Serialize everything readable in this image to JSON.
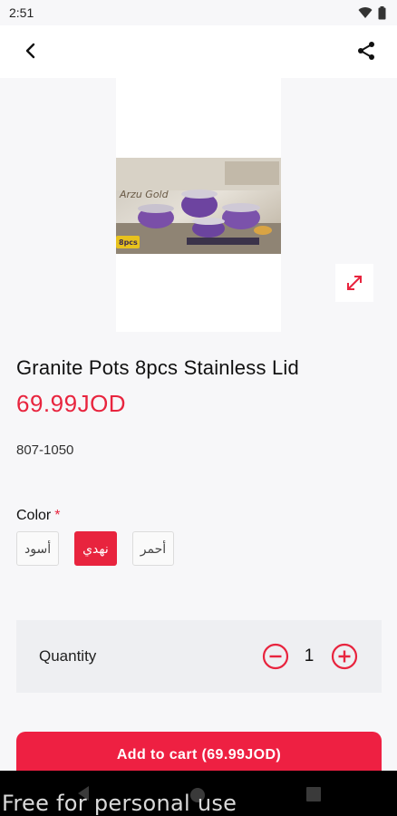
{
  "status_bar": {
    "time": "2:51"
  },
  "product": {
    "title": "Granite Pots 8pcs Stainless Lid",
    "price": "69.99JOD",
    "sku": "807-1050",
    "image_brand_text": "Arzu Gold",
    "image_badge": "8pcs"
  },
  "color": {
    "label": "Color",
    "required_mark": "*",
    "options": [
      "أسود",
      "نهدي",
      "أحمر"
    ],
    "selected": "نهدي"
  },
  "quantity": {
    "label": "Quantity",
    "value": "1"
  },
  "cart": {
    "button_label": "Add to cart (69.99JOD)"
  },
  "watermark": "Free for personal use",
  "colors": {
    "accent": "#e8243e",
    "button": "#ee2042",
    "background": "#f7f7f9"
  },
  "icons": [
    "wifi-icon",
    "battery-icon",
    "back-arrow-icon",
    "share-icon",
    "expand-icon",
    "minus-circle-icon",
    "plus-circle-icon",
    "nav-back-icon",
    "nav-home-icon",
    "nav-recents-icon"
  ]
}
